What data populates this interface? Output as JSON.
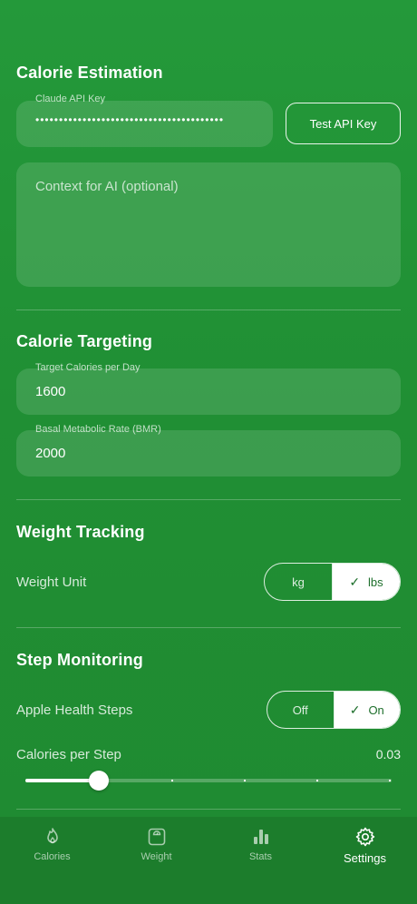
{
  "calorie_estimation": {
    "title": "Calorie Estimation",
    "api_key_label": "Claude API Key",
    "api_key_value": "••••••••••••••••••••••••••••••••••••••••",
    "test_button_label": "Test API Key",
    "context_placeholder": "Context for AI (optional)"
  },
  "calorie_targeting": {
    "title": "Calorie Targeting",
    "target_label": "Target Calories per Day",
    "target_value": "1600",
    "bmr_label": "Basal Metabolic Rate (BMR)",
    "bmr_value": "2000"
  },
  "weight_tracking": {
    "title": "Weight Tracking",
    "unit_label": "Weight Unit",
    "options": [
      "kg",
      "lbs"
    ],
    "selected": "lbs"
  },
  "step_monitoring": {
    "title": "Step Monitoring",
    "health_label": "Apple Health Steps",
    "options": [
      "Off",
      "On"
    ],
    "selected": "On",
    "cps_label": "Calories per Step",
    "cps_value": "0.03",
    "cps_fraction": 0.2
  },
  "tabs": [
    {
      "label": "Calories",
      "icon": "flame-icon"
    },
    {
      "label": "Weight",
      "icon": "scale-icon"
    },
    {
      "label": "Stats",
      "icon": "bar-chart-icon"
    },
    {
      "label": "Settings",
      "icon": "gear-icon",
      "active": true
    }
  ],
  "colors": {
    "background": "#229636",
    "tab_bar": "#1c7d2c",
    "selected_text": "#1e6f2c"
  }
}
